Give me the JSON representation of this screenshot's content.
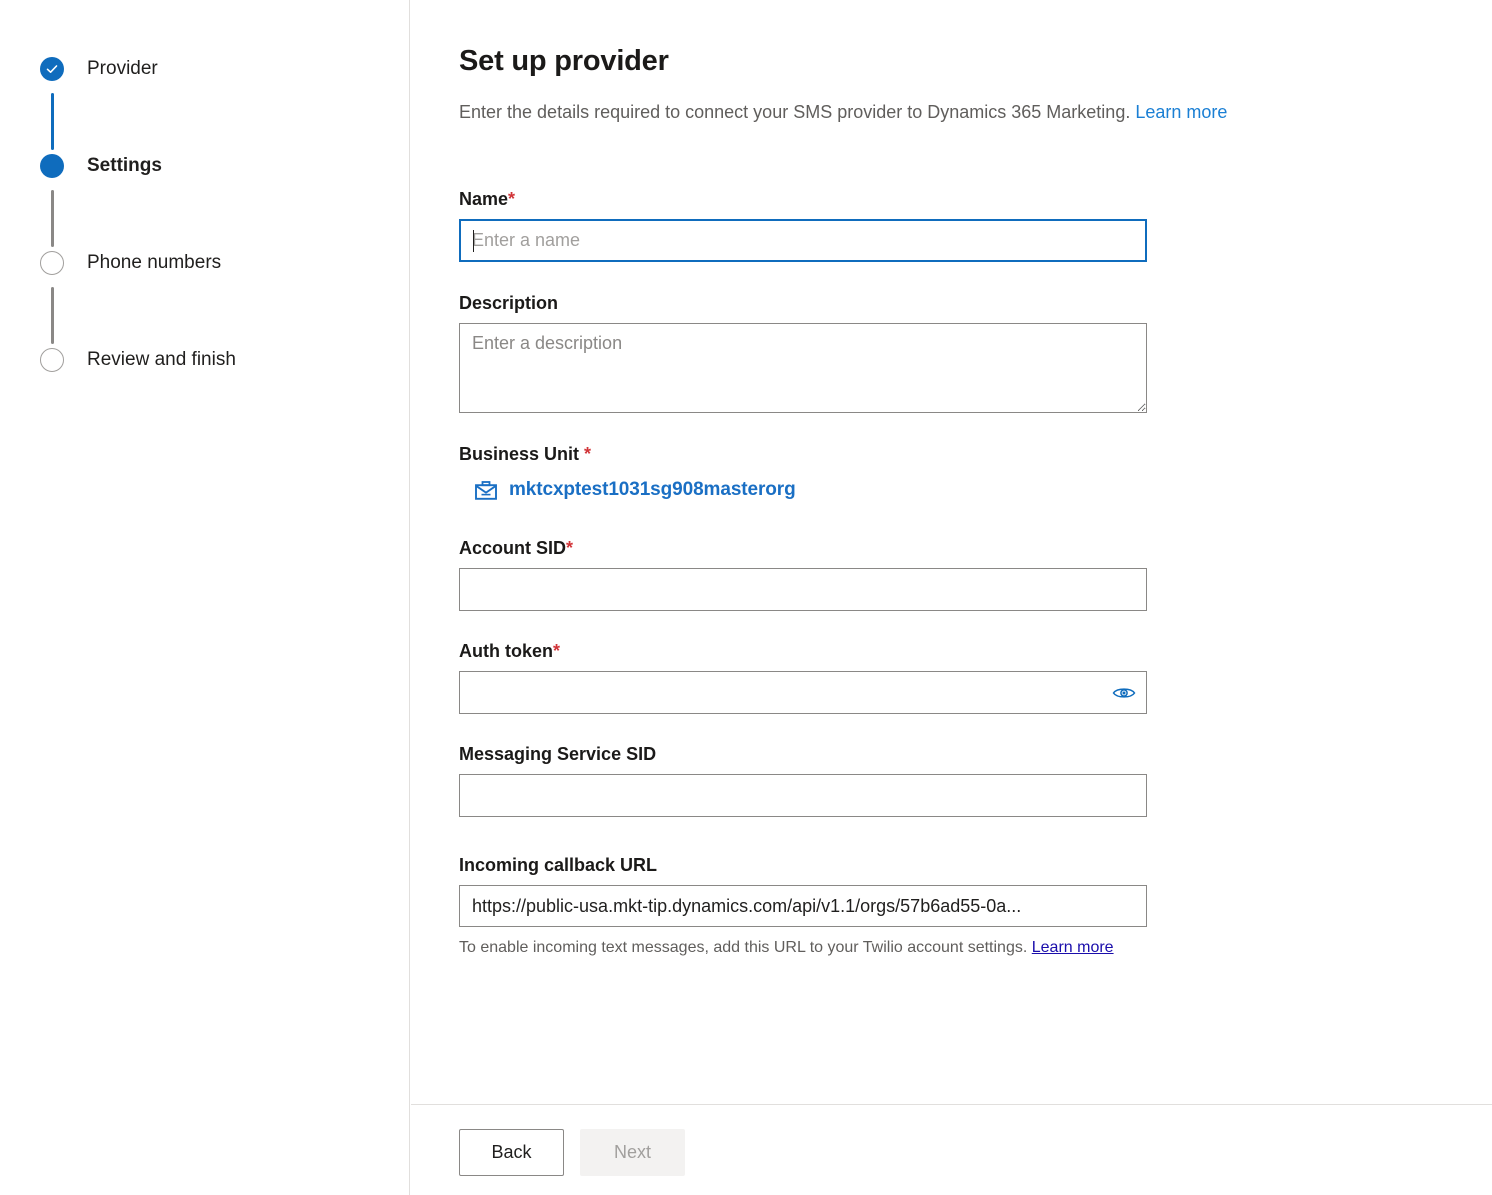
{
  "wizard": {
    "steps": [
      {
        "label": "Provider",
        "state": "done",
        "icon": "check-icon"
      },
      {
        "label": "Settings",
        "state": "active",
        "icon": "filled-circle-icon"
      },
      {
        "label": "Phone numbers",
        "state": "todo",
        "icon": "empty-circle-icon"
      },
      {
        "label": "Review and finish",
        "state": "todo",
        "icon": "empty-circle-icon"
      }
    ]
  },
  "header": {
    "title": "Set up provider",
    "subtitle": "Enter the details required to connect your SMS provider to Dynamics 365 Marketing.",
    "learn_more": "Learn more"
  },
  "form": {
    "name": {
      "label": "Name",
      "required_mark": "*",
      "value": "",
      "placeholder": "Enter a name",
      "focused": true
    },
    "description": {
      "label": "Description",
      "value": "",
      "placeholder": "Enter a description"
    },
    "business_unit": {
      "label": "Business Unit",
      "required_mark": "*",
      "icon": "briefcase-icon",
      "value": "mktcxptest1031sg908masterorg"
    },
    "account_sid": {
      "label": "Account SID",
      "required_mark": "*",
      "value": "",
      "placeholder": ""
    },
    "auth_token": {
      "label": "Auth token",
      "required_mark": "*",
      "value": "",
      "placeholder": "",
      "reveal_icon": "eye-icon"
    },
    "messaging_service_sid": {
      "label": "Messaging Service SID",
      "value": "",
      "placeholder": ""
    },
    "incoming_callback_url": {
      "label": "Incoming callback URL",
      "value": "https://public-usa.mkt-tip.dynamics.com/api/v1.1/orgs/57b6ad55-0a...",
      "helper_text": "To enable incoming text messages, add this URL to your Twilio account settings.",
      "helper_link": "Learn more"
    }
  },
  "footer": {
    "back_label": "Back",
    "next_label": "Next",
    "next_disabled": true
  },
  "colors": {
    "accent": "#0f6cbd",
    "link": "#1a7fd4",
    "visited_link": "#1a0dab",
    "required": "#d13438",
    "border": "#8a8886",
    "divider": "#e1dfdd",
    "disabled_bg": "#f3f2f1",
    "disabled_text": "#a19f9d",
    "muted_text": "#605e5c"
  }
}
